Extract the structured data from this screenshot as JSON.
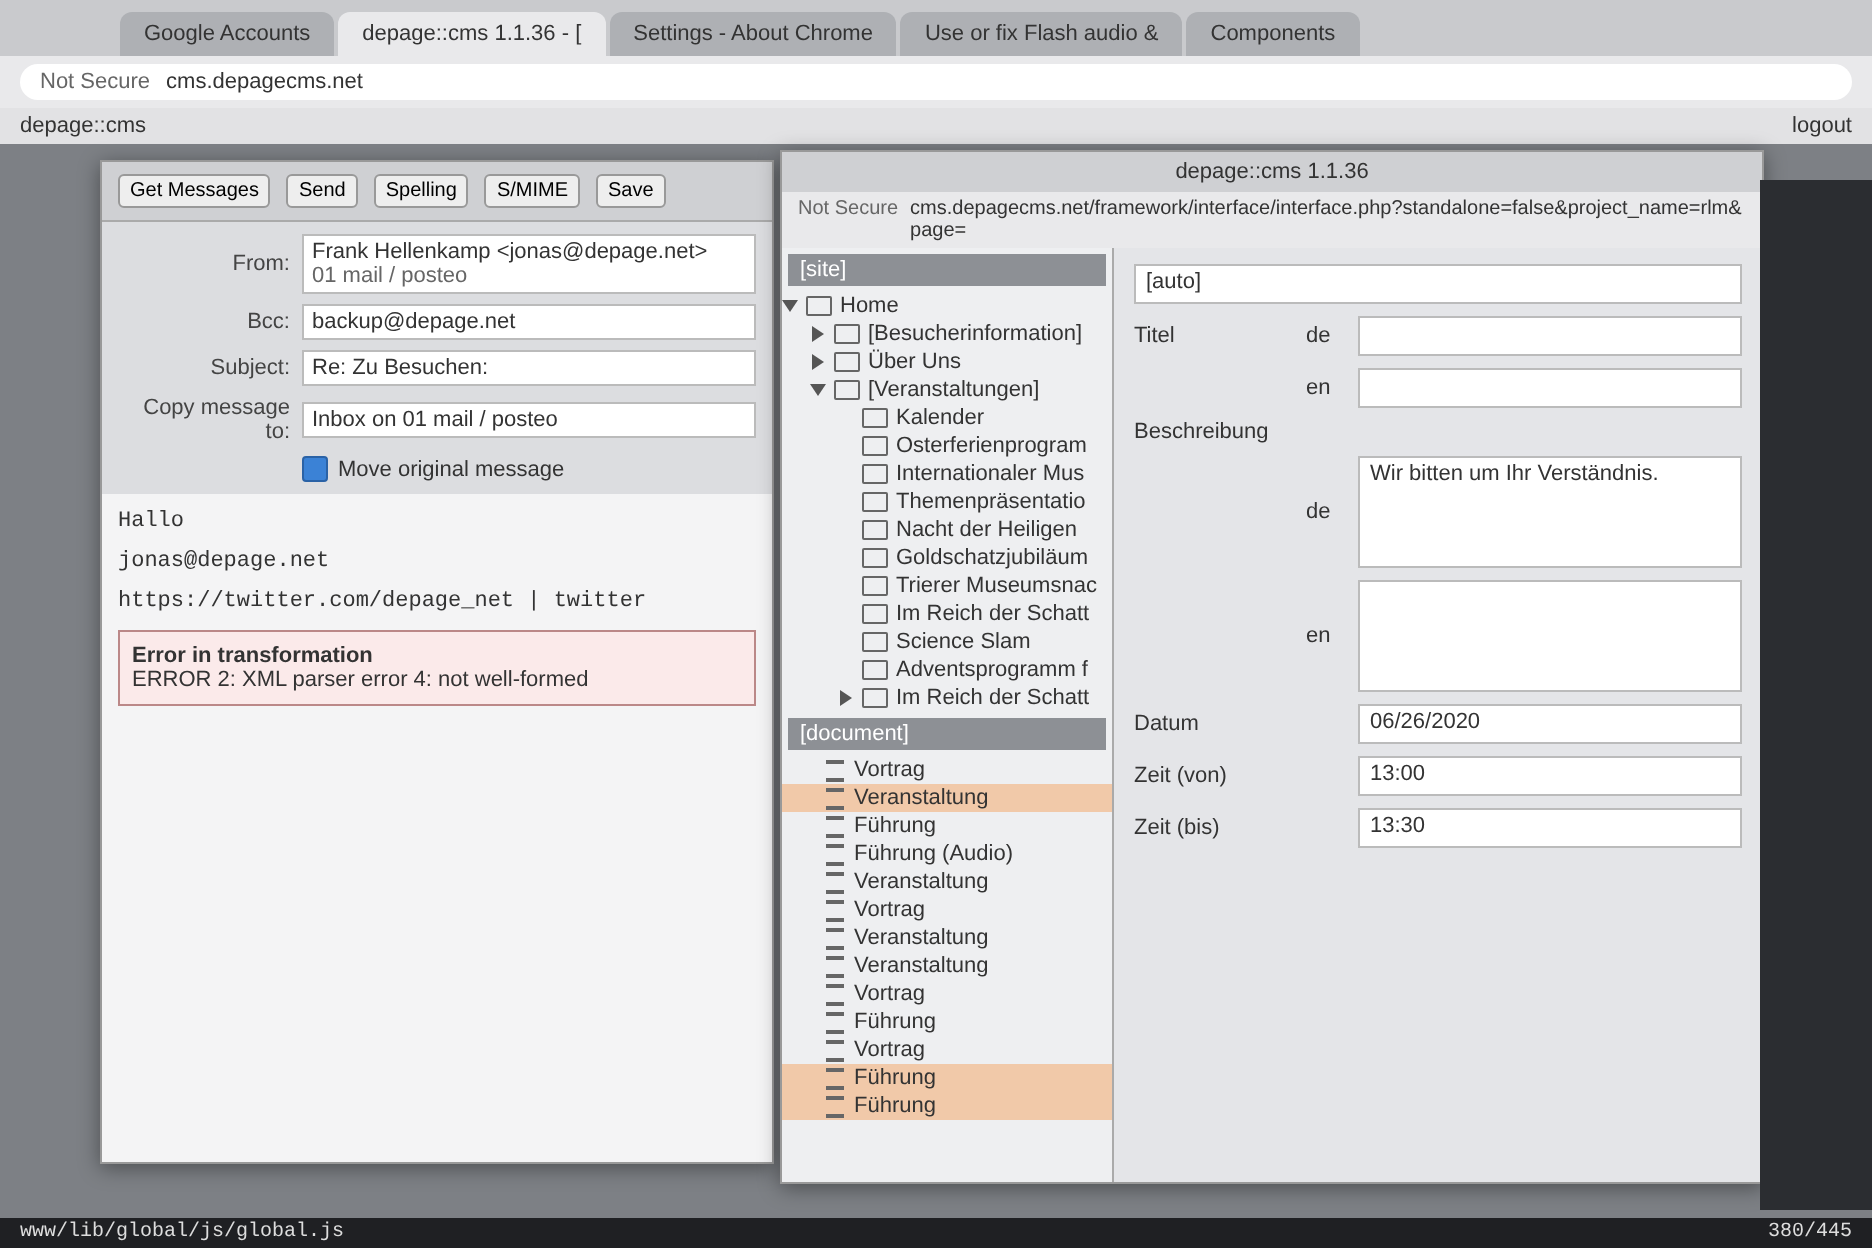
{
  "browser": {
    "tabs": [
      {
        "label": "Google Accounts",
        "selected": false
      },
      {
        "label": "depage::cms 1.1.36 - [",
        "selected": true
      },
      {
        "label": "Settings - About Chrome",
        "selected": false
      },
      {
        "label": "Use or fix Flash audio &",
        "selected": false
      },
      {
        "label": "Components",
        "selected": false
      }
    ],
    "security": "Not Secure",
    "url": "cms.depagecms.net",
    "bookmark": "depage::cms",
    "logout": "logout"
  },
  "mail": {
    "get_messages": "Get Messages",
    "toolbar": [
      "Send",
      "Spelling",
      "S/MIME",
      "Save"
    ],
    "from_label": "From:",
    "from": "Frank Hellenkamp <jonas@depage.net>",
    "account": "01 mail / posteo",
    "bcc_label": "Bcc:",
    "bcc": "backup@depage.net",
    "subject_label": "Subject:",
    "subject": "Re: Zu Besuchen:",
    "copy_label": "Copy message to:",
    "copy_target": "Inbox on 01 mail / posteo",
    "move_original": {
      "label": "Move original message",
      "checked": true
    },
    "body": [
      "Hallo",
      "jonas@depage.net",
      "https://twitter.com/depage_net | twitter"
    ],
    "error": {
      "title": "Error in transformation",
      "message": "ERROR 2: XML parser error 4: not well-formed"
    }
  },
  "cms": {
    "title": "depage::cms 1.1.36",
    "security": "Not Secure",
    "url": "cms.depagecms.net/framework/interface/interface.php?standalone=false&project_name=rlm&page=",
    "site_select": "[site]",
    "tree": [
      {
        "label": "Home",
        "expanded": true,
        "children": [
          {
            "label": "[Besucherinformation]",
            "expanded": false
          },
          {
            "label": "Über Uns",
            "expanded": false
          },
          {
            "label": "[Veranstaltungen]",
            "expanded": true,
            "children": [
              {
                "label": "Kalender"
              },
              {
                "label": "Osterferienprogram"
              },
              {
                "label": "Internationaler Mus"
              },
              {
                "label": "Themenpräsentatio"
              },
              {
                "label": "Nacht der Heiligen"
              },
              {
                "label": "Goldschatzjubiläum"
              },
              {
                "label": "Trierer Museumsnac"
              },
              {
                "label": "Im Reich der Schatt"
              },
              {
                "label": "Science Slam"
              },
              {
                "label": "Adventsprogramm f"
              },
              {
                "label": "Im Reich der Schatt",
                "expanded": false
              }
            ]
          }
        ]
      }
    ],
    "doc_select": "[document]",
    "doc_items": [
      {
        "label": "Vortrag",
        "selected": false
      },
      {
        "label": "Veranstaltung",
        "selected": true
      },
      {
        "label": "Führung",
        "selected": false
      },
      {
        "label": "Führung (Audio)",
        "selected": false
      },
      {
        "label": "Veranstaltung",
        "selected": false
      },
      {
        "label": "Vortrag",
        "selected": false
      },
      {
        "label": "Veranstaltung",
        "selected": false
      },
      {
        "label": "Veranstaltung",
        "selected": false
      },
      {
        "label": "Vortrag",
        "selected": false
      },
      {
        "label": "Führung",
        "selected": false
      },
      {
        "label": "Vortrag",
        "selected": false
      },
      {
        "label": "Führung",
        "selected": true
      },
      {
        "label": "Führung",
        "selected": true
      }
    ],
    "auto_select": "[auto]",
    "title_label": "Titel",
    "description_label": "Beschreibung",
    "title_langs": [
      "de",
      "en"
    ],
    "description_langs": [
      "de",
      "en"
    ],
    "description_de": "Wir bitten um Ihr Verständnis.",
    "fields": [
      {
        "label": "Datum",
        "value": "06/26/2020"
      },
      {
        "label": "Zeit (von)",
        "value": "13:00"
      },
      {
        "label": "Zeit (bis)",
        "value": "13:30"
      }
    ]
  },
  "status_bar": {
    "path": "www/lib/global/js/global.js",
    "position": "380/445"
  }
}
